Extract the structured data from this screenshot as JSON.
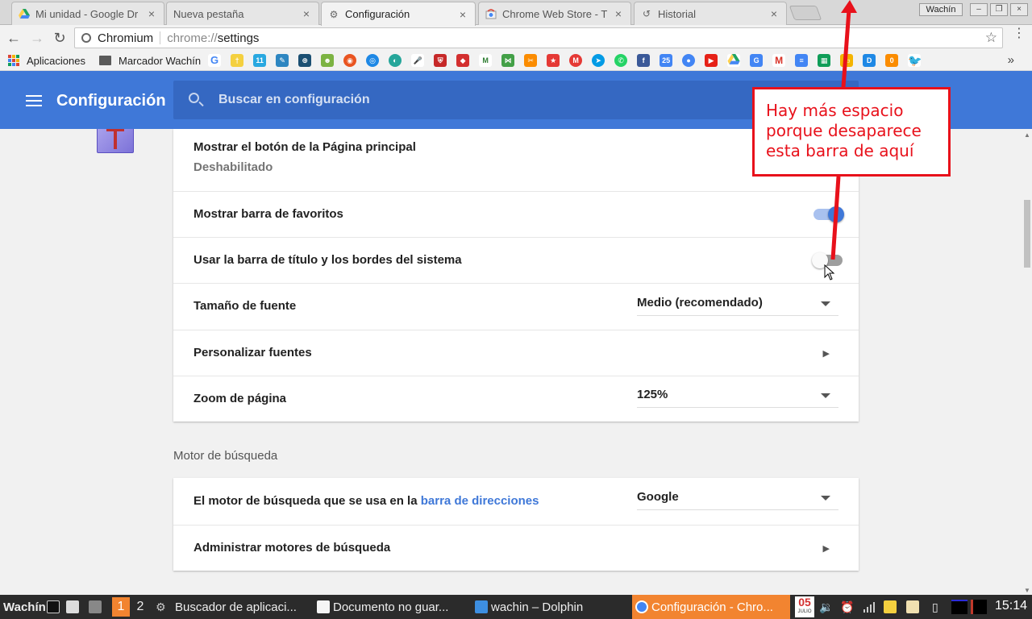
{
  "browser": {
    "tabs": [
      {
        "label": "Mi unidad - Google Dr",
        "icon": "google-drive-icon"
      },
      {
        "label": "Nueva pestaña",
        "icon": ""
      },
      {
        "label": "Configuración",
        "icon": "gear-icon"
      },
      {
        "label": "Chrome Web Store - T",
        "icon": "chrome-web-store-icon"
      },
      {
        "label": "Historial",
        "icon": "history-icon"
      }
    ],
    "active_tab": 2,
    "window_user": "Wachín",
    "omnibox": {
      "origin": "Chromium",
      "scheme": "chrome://",
      "path": "settings"
    },
    "bookmarks": {
      "apps_label": "Aplicaciones",
      "folder_label": "Marcador Wachín",
      "more": "»"
    }
  },
  "settings": {
    "title": "Configuración",
    "search_placeholder": "Buscar en configuración",
    "appearance": {
      "home_button": {
        "label": "Mostrar el botón de la Página principal",
        "status": "Deshabilitado"
      },
      "bookmarks_bar": {
        "label": "Mostrar barra de favoritos",
        "enabled": true
      },
      "system_title_bar": {
        "label": "Usar la barra de título y los bordes del sistema",
        "enabled": false
      },
      "font_size": {
        "label": "Tamaño de fuente",
        "value": "Medio (recomendado)"
      },
      "custom_fonts": {
        "label": "Personalizar fuentes"
      },
      "page_zoom": {
        "label": "Zoom de página",
        "value": "125%"
      }
    },
    "search_engine_section": {
      "title": "Motor de búsqueda",
      "engine": {
        "label_prefix": "El motor de búsqueda que se usa en la",
        "label_link": "barra de direcciones",
        "value": "Google"
      },
      "manage": {
        "label": "Administrar motores de búsqueda"
      }
    }
  },
  "annotation": {
    "text": "Hay más espacio porque desaparece esta barra de aquí",
    "color": "#e8111b"
  },
  "taskbar": {
    "user": "Wachín",
    "workspaces": [
      "1",
      "2"
    ],
    "windows": [
      {
        "label": "Buscador de aplicaci..."
      },
      {
        "label": "Documento no guar..."
      },
      {
        "label": "wachin – Dolphin"
      },
      {
        "label": "Configuración - Chro..."
      }
    ],
    "calendar_day": "05",
    "calendar_month": "JULIO",
    "clock": "15:14"
  },
  "colors": {
    "accent": "#3f78d8",
    "header": "#3f78d8",
    "taskbar_active": "#f28430"
  }
}
